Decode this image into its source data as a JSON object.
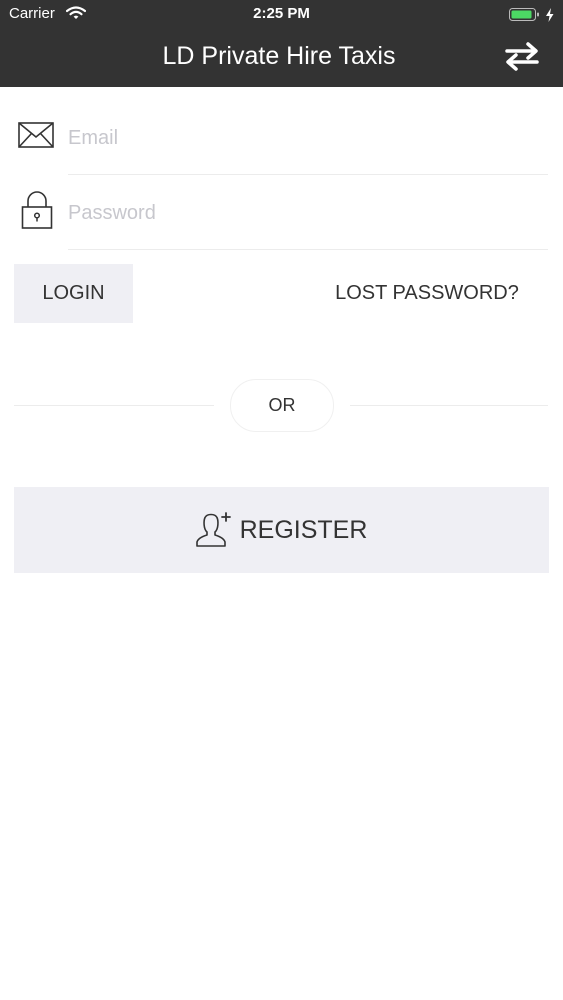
{
  "status_bar": {
    "carrier": "Carrier",
    "time": "2:25 PM",
    "icons": [
      "wifi-icon",
      "battery-icon",
      "charging-icon"
    ],
    "battery_color": "#4cd964"
  },
  "header": {
    "title": "LD Private Hire Taxis",
    "action_icon": "swap-arrows-icon",
    "background": "#333333"
  },
  "form": {
    "email": {
      "icon": "envelope-icon",
      "placeholder": "Email",
      "value": ""
    },
    "password": {
      "icon": "lock-icon",
      "placeholder": "Password",
      "value": ""
    },
    "login_label": "LOGIN",
    "lost_password_label": "LOST PASSWORD?"
  },
  "divider": {
    "label": "OR"
  },
  "register": {
    "icon": "add-user-icon",
    "label": "REGISTER"
  }
}
